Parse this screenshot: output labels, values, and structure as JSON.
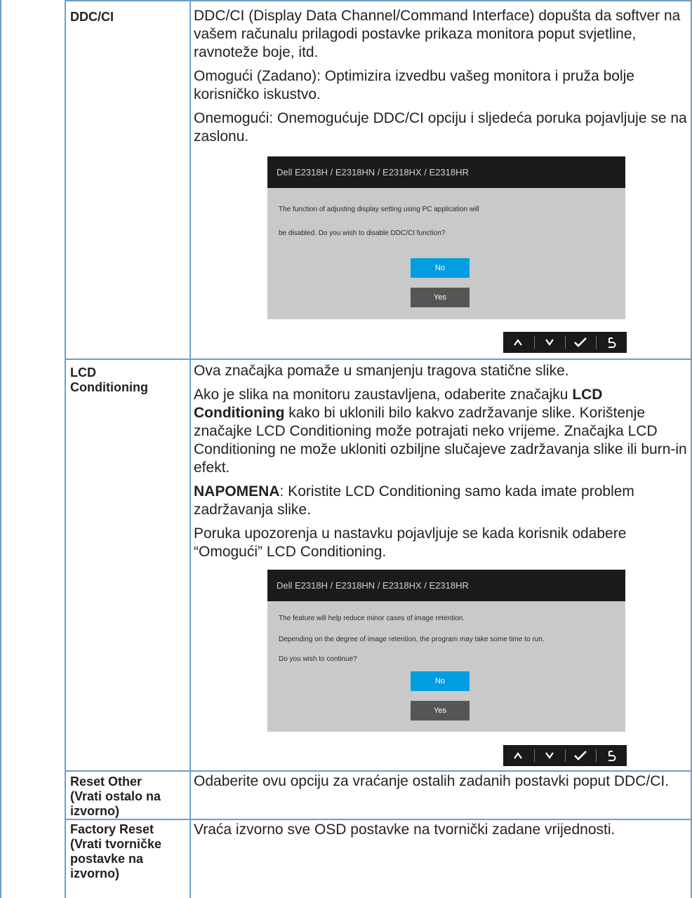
{
  "rows": [
    {
      "name": "DDC/CI",
      "paragraphs": [
        "DDC/CI (Display Data Channel/Command Interface) dopušta da softver na vašem računalu prilagodi postavke prikaza monitora poput svjetline, ravnoteže boje, itd.",
        "Omogući (Zadano): Optimizira izvedbu vašeg monitora i pruža bolje korisničko iskustvo.",
        "Onemogući: Onemogućuje DDC/CI opciju i sljedeća poruka pojavljuje se na zaslonu."
      ],
      "dialog": {
        "title": "Dell E2318H / E2318HN / E2318HX / E2318HR",
        "lines": [
          "The function of adjusting display setting using PC application will",
          "be disabled. Do you wish to disable DDC/CI function?"
        ],
        "no_label": "No",
        "yes_label": "Yes"
      }
    },
    {
      "name_line1": "LCD",
      "name_line2": "Conditioning",
      "p1": "Ova značajka pomaže u smanjenju tragova statične slike.",
      "p2_part1": "Ako je slika na monitoru zaustavljena, odaberite značajku ",
      "p2_bold": "LCD Conditioning",
      "p2_part2": " kako bi uklonili bilo kakvo zadržavanje slike. Korištenje značajke LCD Conditioning može potrajati neko vrijeme. Značajka LCD Conditioning ne može ukloniti ozbiljne slučajeve zadržavanja slike ili burn-in efekt.",
      "note_label": "NAPOMENA",
      "note_text": ": Koristite LCD Conditioning samo kada imate problem zadržavanja slike.",
      "p4": "Poruka upozorenja u nastavku pojavljuje se kada korisnik odabere “Omogući” LCD Conditioning.",
      "dialog": {
        "title": "Dell E2318H / E2318HN / E2318HX / E2318HR",
        "lines": [
          "The feature will help reduce minor cases of image retention.",
          "Depending on the degree of image retention, the program may take some time to run.",
          "Do you wish to continue?"
        ],
        "no_label": "No",
        "yes_label": "Yes"
      }
    },
    {
      "name_lines": [
        "Reset Other",
        "(Vrati ostalo na",
        "izvorno)"
      ],
      "desc": "Odaberite ovu opciju za vraćanje ostalih zadanih postavki poput DDC/CI."
    },
    {
      "name_lines": [
        "Factory Reset",
        "(Vrati tvorničke",
        "postavke na",
        "izvorno)"
      ],
      "desc": "Vraća izvorno sve OSD postavke na tvornički zadane vrijednosti."
    }
  ],
  "nav_icons": [
    "up-arrow-icon",
    "down-arrow-icon",
    "check-icon",
    "back-icon"
  ],
  "colors": {
    "border": "#6e9fc8",
    "osd_title_bg": "#1b1b1b",
    "osd_body_bg": "#c9c9c9",
    "no_button": "#009ee0",
    "yes_button": "#555555",
    "navbar_bg": "#1a1a1a"
  }
}
